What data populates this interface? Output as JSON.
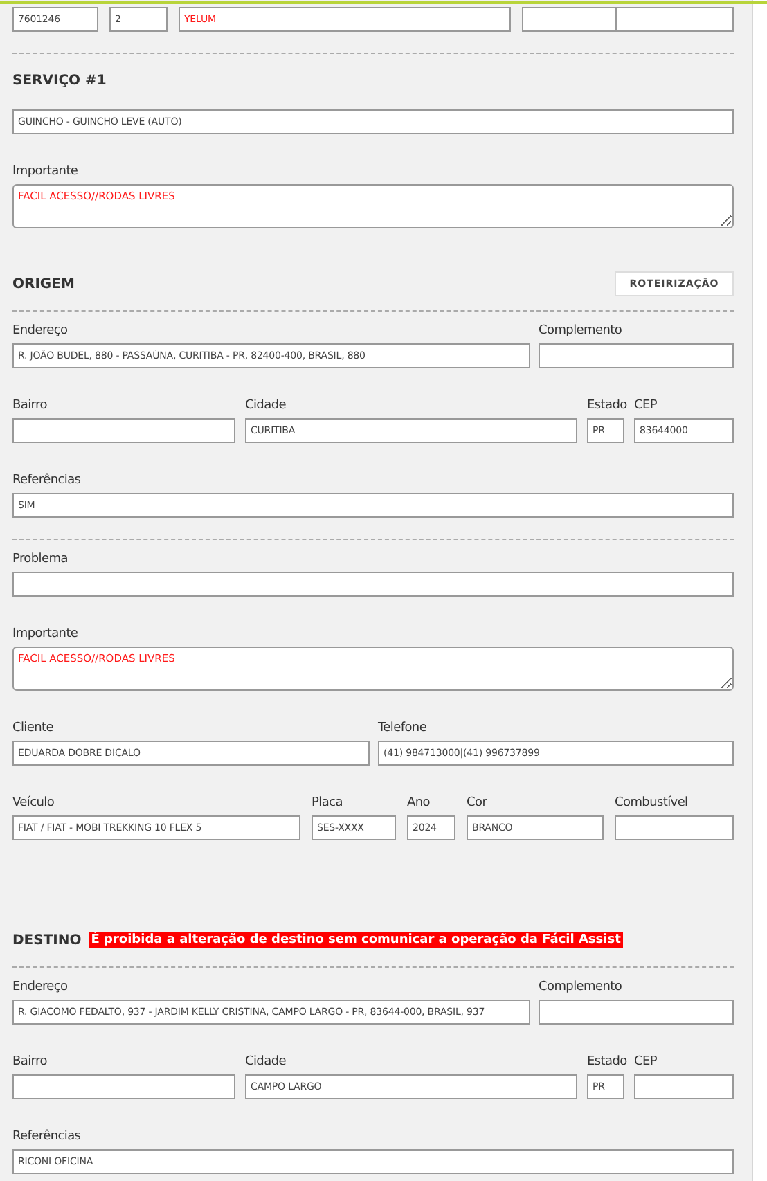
{
  "blocks": [
    {
      "kind": "top_row",
      "fields": [
        {
          "kind": "input",
          "value": "7601246",
          "alert": false
        },
        {
          "kind": "input",
          "value": "2",
          "alert": false
        },
        {
          "kind": "input",
          "value": "YELUM",
          "alert": true
        },
        {
          "kind": "input"
        },
        {
          "kind": "input"
        }
      ]
    },
    {
      "kind": "divider"
    },
    {
      "kind": "heading",
      "title": "SERVIÇO #1"
    },
    {
      "kind": "full_row",
      "fields": [
        {
          "kind": "input",
          "value": "GUINCHO - GUINCHO LEVE (AUTO)",
          "alert": false
        }
      ]
    },
    {
      "kind": "full_row",
      "fields": [
        {
          "kind": "textarea",
          "label": "Importante",
          "value": "FACIL ACESSO//RODAS LIVRES",
          "alert": true
        }
      ]
    },
    {
      "kind": "heading",
      "title": "ORIGEM",
      "button": "ROTEIRIZAÇÃO"
    },
    {
      "kind": "divider"
    },
    {
      "kind": "address_row",
      "fields": [
        {
          "kind": "input",
          "label": "Endereço",
          "value": "R. JOÃO BUDEL, 880 - PASSAÚNA, CURITIBA - PR, 82400-400, BRASIL, 880",
          "alert": false
        },
        {
          "kind": "input",
          "label": "Complemento"
        }
      ]
    },
    {
      "kind": "city_row",
      "fields": [
        {
          "kind": "input",
          "label": "Bairro"
        },
        {
          "kind": "input",
          "label": "Cidade",
          "value": "CURITIBA",
          "alert": false
        },
        {
          "kind": "input",
          "label": "Estado",
          "value": "PR",
          "alert": false
        },
        {
          "kind": "input",
          "label": "CEP",
          "value": "83644000",
          "alert": false
        }
      ]
    },
    {
      "kind": "full_row",
      "fields": [
        {
          "kind": "input",
          "label": "Referências",
          "value": "SIM",
          "alert": false
        }
      ]
    },
    {
      "kind": "divider"
    },
    {
      "kind": "full_row",
      "fields": [
        {
          "kind": "input",
          "label": "Problema"
        }
      ]
    },
    {
      "kind": "full_row",
      "fields": [
        {
          "kind": "textarea",
          "label": "Importante",
          "value": "FACIL ACESSO//RODAS LIVRES",
          "alert": true
        }
      ]
    },
    {
      "kind": "client_row",
      "fields": [
        {
          "kind": "input",
          "label": "Cliente",
          "value": "EDUARDA DOBRE DICALO",
          "alert": false
        },
        {
          "kind": "input",
          "label": "Telefone",
          "value": "(41) 984713000|(41) 996737899",
          "alert": false
        }
      ]
    },
    {
      "kind": "vehicle_row",
      "fields": [
        {
          "kind": "input",
          "label": "Veículo",
          "value": "FIAT / FIAT - MOBI TREKKING 10 FLEX 5",
          "alert": false
        },
        {
          "kind": "input",
          "label": "Placa",
          "value": "SES-XXXX",
          "alert": false
        },
        {
          "kind": "input",
          "label": "Ano",
          "value": "2024",
          "alert": false
        },
        {
          "kind": "input",
          "label": "Cor",
          "value": "BRANCO",
          "alert": false
        },
        {
          "kind": "input",
          "label": "Combustível"
        }
      ]
    },
    {
      "kind": "heading",
      "title": "DESTINO",
      "notice": "É proibida a alteração de destino sem comunicar a operação da Fácil Assist"
    },
    {
      "kind": "divider"
    },
    {
      "kind": "address_row",
      "fields": [
        {
          "kind": "input",
          "label": "Endereço",
          "value": "R. GIACOMO FEDALTO, 937 - JARDIM KELLY CRISTINA, CAMPO LARGO - PR, 83644-000, BRASIL, 937",
          "alert": false
        },
        {
          "kind": "input",
          "label": "Complemento"
        }
      ]
    },
    {
      "kind": "city_row",
      "fields": [
        {
          "kind": "input",
          "label": "Bairro"
        },
        {
          "kind": "input",
          "label": "Cidade",
          "value": "CAMPO LARGO",
          "alert": false
        },
        {
          "kind": "input",
          "label": "Estado",
          "value": "PR",
          "alert": false
        },
        {
          "kind": "input",
          "label": "CEP"
        }
      ]
    },
    {
      "kind": "full_row",
      "fields": [
        {
          "kind": "input",
          "label": "Referências",
          "value": "RICONI OFICINA",
          "alert": false
        }
      ]
    }
  ]
}
